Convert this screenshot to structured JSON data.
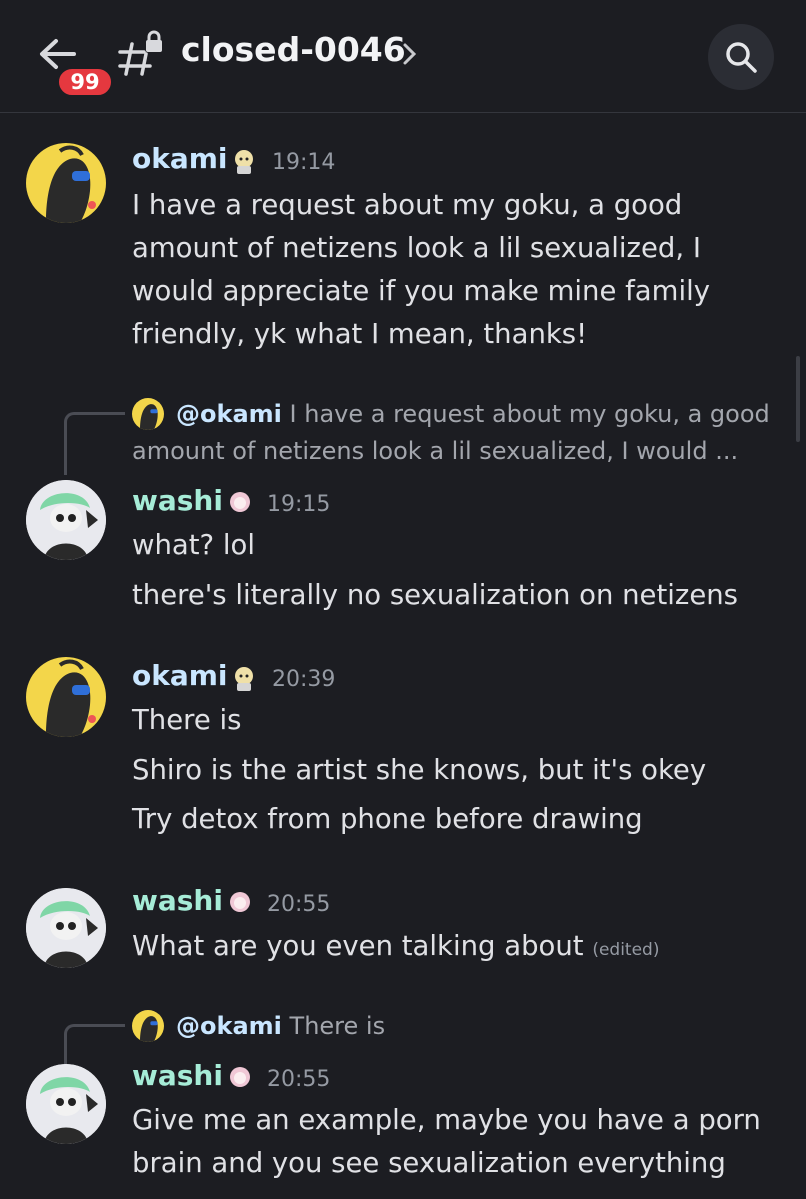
{
  "header": {
    "channel_name": "closed-0046",
    "unread_badge": "99"
  },
  "messages": [
    {
      "author": "okami",
      "time": "19:14",
      "lines": [
        "I have a request about my goku, a good",
        "amount of netizens look a lil sexualized, I",
        "would appreciate if you make mine family",
        "friendly, yk what I mean, thanks!"
      ]
    },
    {
      "reply": {
        "mention": "@okami",
        "line1": "I have a request about my goku, a good",
        "line2": "amount of netizens look a lil sexualized, I would ..."
      },
      "author": "washi",
      "time": "19:15",
      "lines": [
        "what? lol",
        "there's literally no sexualization on netizens"
      ]
    },
    {
      "author": "okami",
      "time": "20:39",
      "lines": [
        "There is",
        "Shiro is the artist she knows, but it's okey",
        "Try detox from phone before drawing"
      ]
    },
    {
      "author": "washi",
      "time": "20:55",
      "lines": [
        "What are you even talking about"
      ],
      "edited": "(edited)"
    },
    {
      "reply": {
        "mention": "@okami",
        "line1": "There is"
      },
      "author": "washi",
      "time": "20:55",
      "lines": [
        "Give me an example, maybe you have a porn",
        "brain and you see sexualization everything"
      ]
    }
  ],
  "icons": {
    "back": "arrow-left-icon",
    "channel": "locked-thread-icon",
    "search": "search-icon"
  },
  "colors": {
    "background": "#1c1d22",
    "okami_name": "#c9e6ff",
    "washi_name": "#a6ecd7",
    "badge": "#e5383f"
  }
}
